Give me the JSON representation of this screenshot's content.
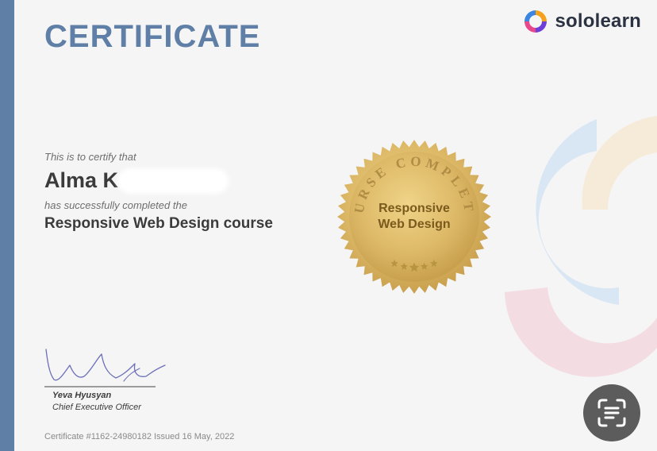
{
  "certificate": {
    "heading": "CERTIFICATE",
    "certify_intro": "This is to certify that",
    "recipient_name": "Alma K",
    "completion_text": "has successfully completed the",
    "course_title": "Responsive Web Design course",
    "footer": "Certificate #1162-24980182 Issued 16 May, 2022"
  },
  "brand": {
    "name": "sololearn",
    "logo_icon": "sololearn-logo-icon",
    "colors": [
      "#e8478b",
      "#f4a11c",
      "#3a86e0",
      "#6e3fd8"
    ]
  },
  "seal": {
    "arc_text": "COURSE COMPLETED",
    "course_line_1": "Responsive",
    "course_line_2": "Web Design",
    "star_count": 5,
    "color": "#d9b25e"
  },
  "signatory": {
    "name": "Yeva Hyusyan",
    "title": "Chief Executive Officer"
  },
  "overlay": {
    "scan_icon": "text-scan-icon"
  },
  "colors": {
    "accent": "#5f7fa6",
    "text": "#3b3b3b"
  }
}
